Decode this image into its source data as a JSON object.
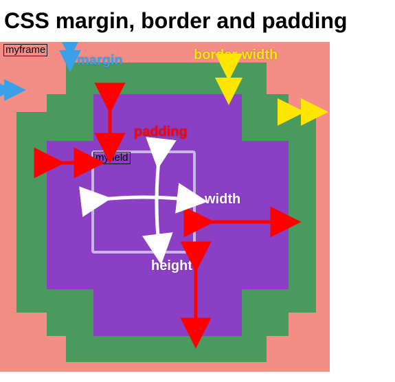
{
  "title": "CSS margin, border and padding",
  "labels": {
    "frame": "myframe",
    "field": "myfield",
    "margin": "margin",
    "border_width": "border-width",
    "padding": "padding",
    "width": "width",
    "height": "height"
  },
  "colors": {
    "margin": "#f38e87",
    "border": "#4a9a5f",
    "padding": "#8a3fc4",
    "content_outline": "#c9b6e6",
    "arrow_margin": "#3aa0e8",
    "arrow_border": "#ffe600",
    "arrow_padding": "#ff0000",
    "arrow_content": "#ffffff"
  }
}
